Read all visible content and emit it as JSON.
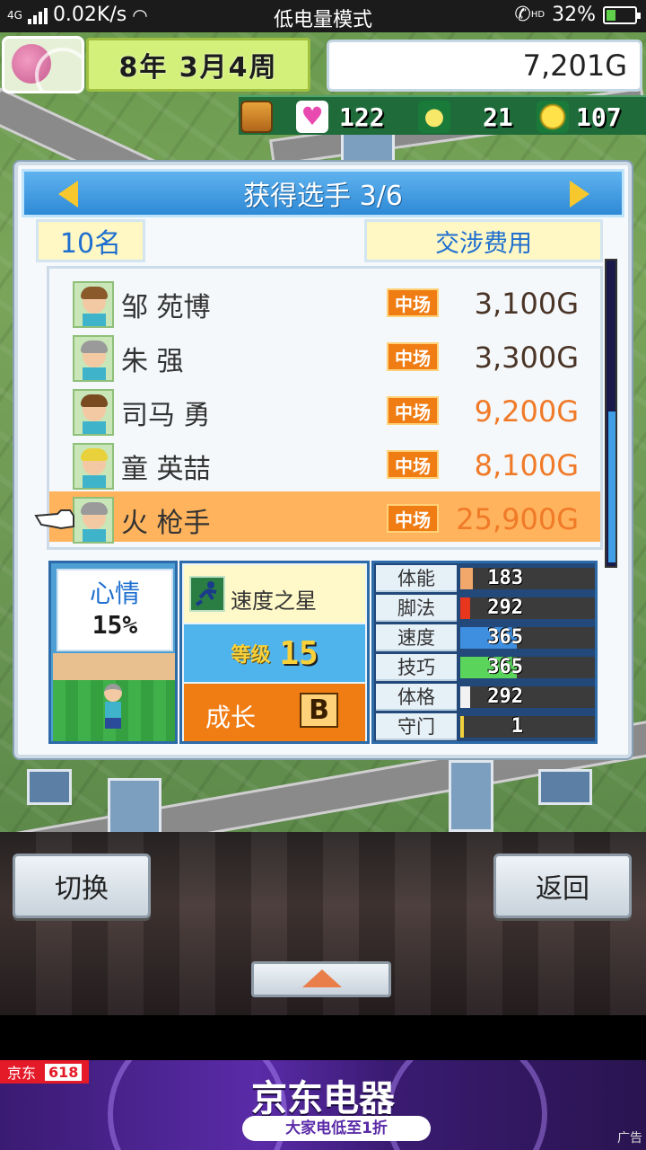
{
  "status_bar": {
    "network": "4G",
    "speed": "0.02K/s",
    "mode": "低电量模式",
    "hd": "HD",
    "battery": "32%",
    "battery_level": 0.32
  },
  "hud": {
    "date": "8年 3月4周",
    "money": "7,201G",
    "res_1": "122",
    "res_2": "21",
    "res_3": "107"
  },
  "dialog": {
    "title": "获得选手 3/6",
    "count": "10名",
    "fee_header": "交涉费用"
  },
  "players": [
    {
      "name": "邹 苑博",
      "position": "中场",
      "fee": "3,100G",
      "hair": "#8a5a2b",
      "expensive": false,
      "selected": false
    },
    {
      "name": "朱 强",
      "position": "中场",
      "fee": "3,300G",
      "hair": "#9a9a9a",
      "expensive": false,
      "selected": false
    },
    {
      "name": "司马 勇",
      "position": "中场",
      "fee": "9,200G",
      "hair": "#7a4a20",
      "expensive": true,
      "selected": false
    },
    {
      "name": "童 英喆",
      "position": "中场",
      "fee": "8,100G",
      "hair": "#e8d13a",
      "expensive": true,
      "selected": false
    },
    {
      "name": "火 枪手",
      "position": "中场",
      "fee": "25,900G",
      "hair": "#9a9a9a",
      "expensive": true,
      "selected": true
    }
  ],
  "mood": {
    "label": "心情",
    "value": "15%"
  },
  "skill": {
    "name": "速度之星",
    "level_label": "等级",
    "level": "15",
    "growth_label": "成长",
    "growth": "B"
  },
  "stats": [
    {
      "name": "体能",
      "value": "183",
      "color": "#f3a86b",
      "fill": 0.09
    },
    {
      "name": "脚法",
      "value": "292",
      "color": "#e8351e",
      "fill": 0.07
    },
    {
      "name": "速度",
      "value": "365",
      "color": "#3f8fe0",
      "fill": 0.42
    },
    {
      "name": "技巧",
      "value": "365",
      "color": "#5ad45a",
      "fill": 0.42
    },
    {
      "name": "体格",
      "value": "292",
      "color": "#f2f2f2",
      "fill": 0.07
    },
    {
      "name": "守门",
      "value": "1",
      "color": "#f2d23a",
      "fill": 0.01
    }
  ],
  "controls": {
    "switch_label": "切换",
    "back_label": "返回"
  },
  "ad": {
    "brand": "京东",
    "promo": "618",
    "headline": "京东电器",
    "sub": "大家电低至1折",
    "tag": "广告"
  }
}
